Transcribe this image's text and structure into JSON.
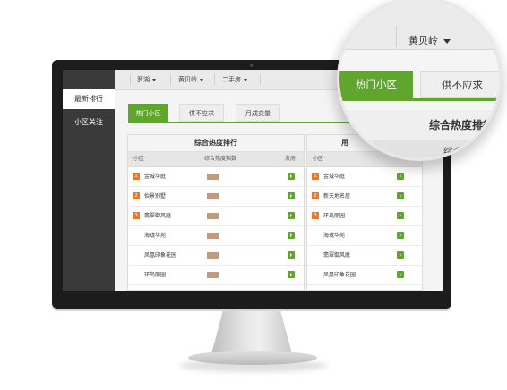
{
  "sidebar": {
    "items": [
      {
        "label": "最新排行",
        "active": true
      },
      {
        "label": "小区关注",
        "active": false
      }
    ]
  },
  "topnav": {
    "dropdowns": [
      "罗湖",
      "黄贝岭",
      "二手房"
    ]
  },
  "tabs": [
    {
      "label": "热门小区",
      "active": true
    },
    {
      "label": "供不应求",
      "active": false
    },
    {
      "label": "月成交量",
      "active": false
    }
  ],
  "panel_left": {
    "title": "综合热度排行",
    "columns": [
      "小区",
      "综合热度指数",
      "发房"
    ],
    "rows": [
      {
        "rank": "1",
        "name": "金城华庭"
      },
      {
        "rank": "2",
        "name": "怡景别墅"
      },
      {
        "rank": "3",
        "name": "翡翠御风庭"
      },
      {
        "rank": "",
        "name": "海珑华苑"
      },
      {
        "rank": "",
        "name": "凤凰印象花园"
      },
      {
        "rank": "",
        "name": "环岛丽园"
      }
    ]
  },
  "panel_right": {
    "title": "用",
    "columns": [
      "小区"
    ],
    "rows": [
      {
        "rank": "1",
        "name": "金城华庭"
      },
      {
        "rank": "2",
        "name": "新天地名居"
      },
      {
        "rank": "3",
        "name": "环岛丽园"
      },
      {
        "rank": "",
        "name": "海珑华苑"
      },
      {
        "rank": "",
        "name": "翡翠御风庭"
      },
      {
        "rank": "",
        "name": "凤凰印象花园"
      }
    ]
  },
  "magnifier": {
    "user": "黄贝岭",
    "tabs": [
      "热门小区",
      "供不应求"
    ],
    "panel_title": "综合热度排行",
    "column_label": "综合热度指"
  },
  "colors": {
    "accent": "#5fa52e",
    "rank": "#e8782a",
    "heat": "#c29b7f"
  }
}
